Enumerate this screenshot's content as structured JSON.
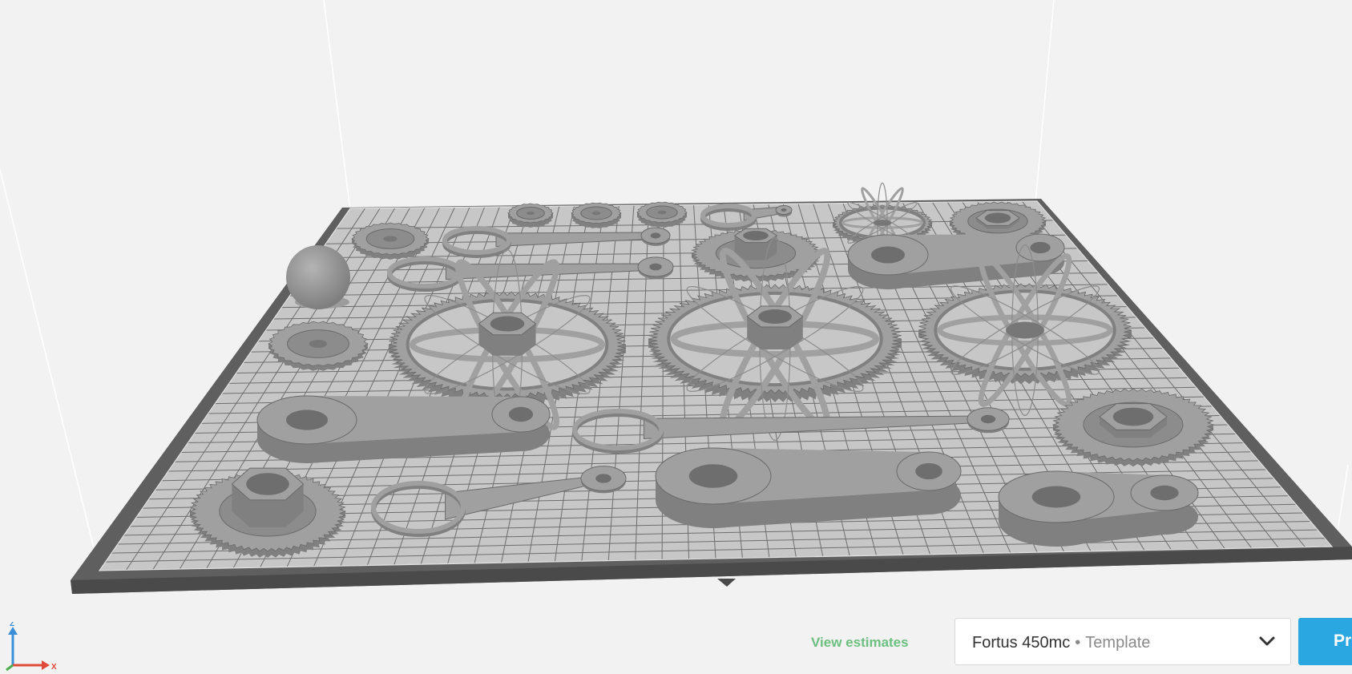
{
  "axis_triad": {
    "z_label": "Z",
    "x_label": "X"
  },
  "footer": {
    "view_estimates_label": "View estimates",
    "printer_name": "Fortus 450mc",
    "separator": "•",
    "printer_mode": "Template",
    "print_button_label": "Print"
  },
  "icons": {
    "dropdown": "chevron-down-icon"
  },
  "colors": {
    "background": "#f2f2f2",
    "bed": "#c7c7c7",
    "part": "#9a9a9a",
    "accent_green": "#6cbf7f",
    "accent_blue": "#2aa6e0"
  }
}
